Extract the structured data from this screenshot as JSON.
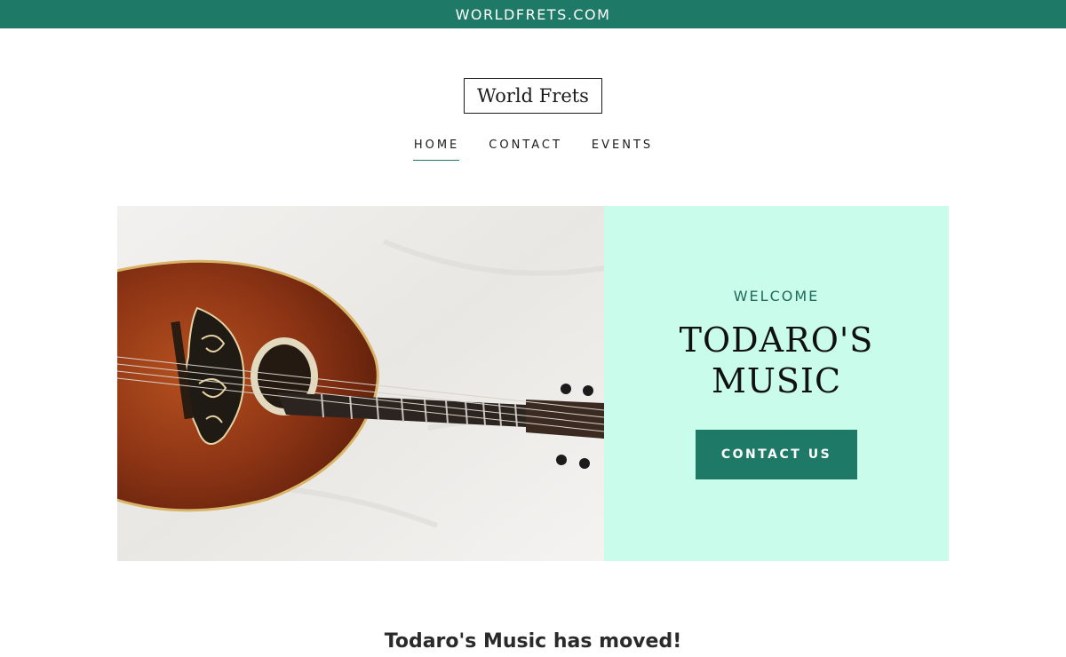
{
  "topbar": {
    "label": "WORLDFRETS.COM"
  },
  "logo": {
    "text": "World Frets"
  },
  "nav": {
    "items": [
      {
        "label": "HOME",
        "active": true
      },
      {
        "label": "CONTACT",
        "active": false
      },
      {
        "label": "EVENTS",
        "active": false
      }
    ]
  },
  "hero": {
    "image_subject": "mandolin",
    "eyebrow": "WELCOME",
    "title_line1": "TODARO'S",
    "title_line2": "MUSIC",
    "cta_label": "CONTACT US",
    "panel_color": "#c9fcea"
  },
  "content": {
    "heading": "Todaro's Music has moved!"
  },
  "colors": {
    "accent": "#1e7a66",
    "panel": "#c9fcea",
    "text": "#1b1b1b"
  }
}
